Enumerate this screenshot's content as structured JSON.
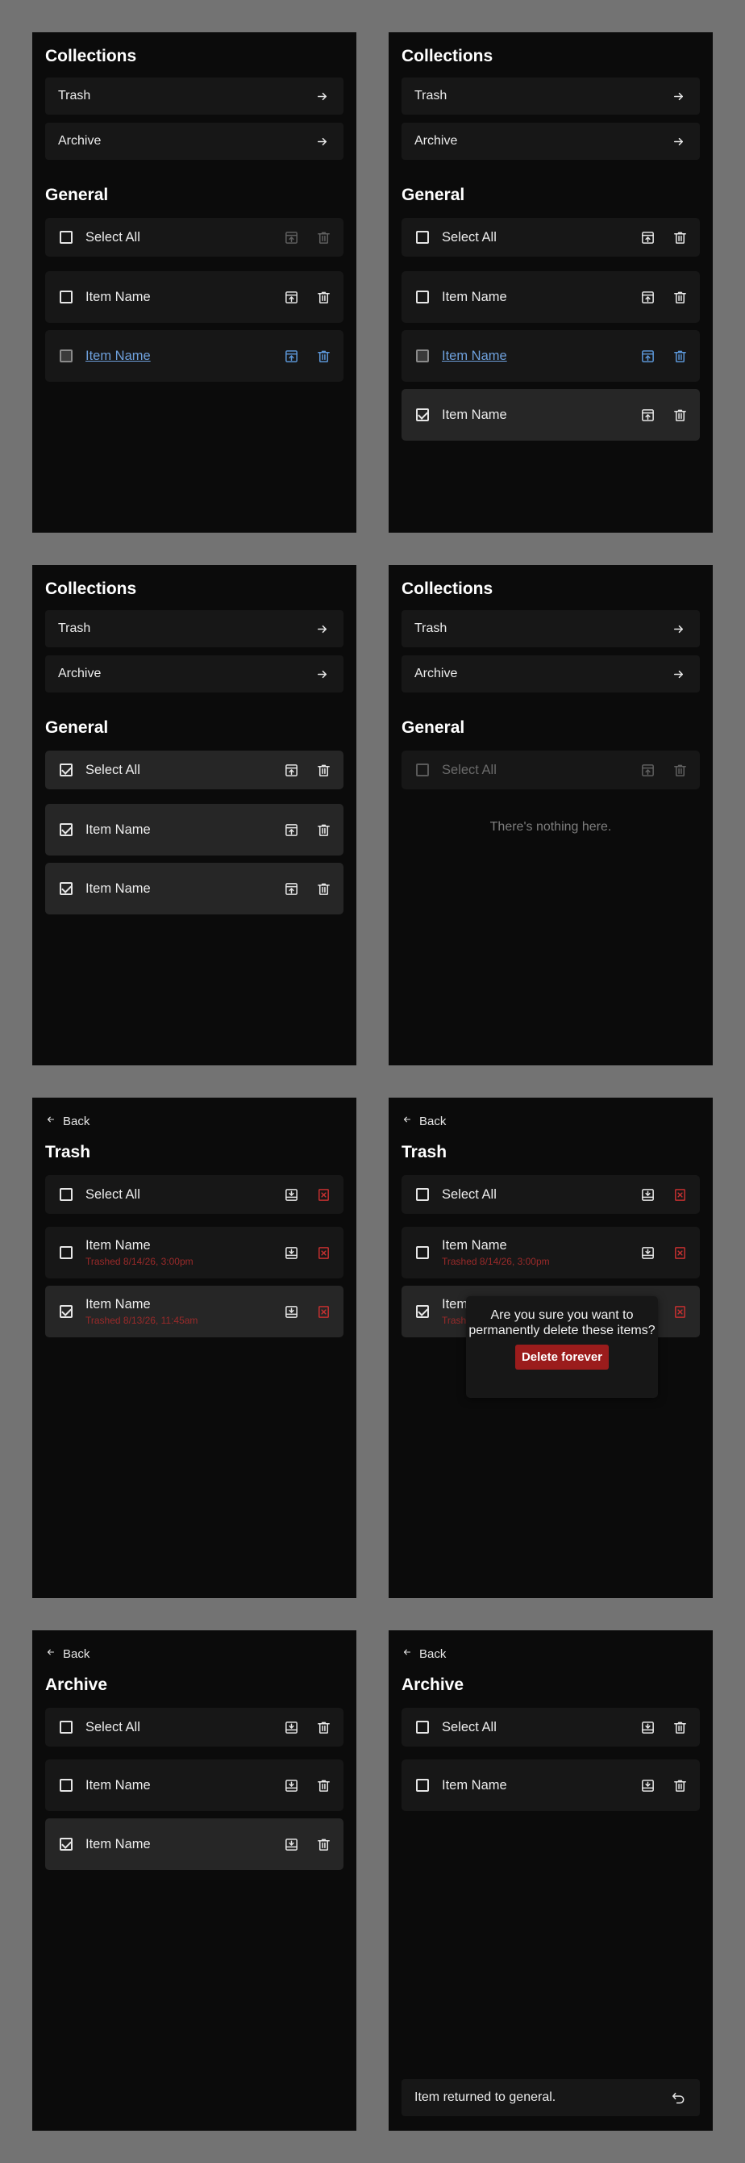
{
  "labels": {
    "collections": "Collections",
    "trash": "Trash",
    "archive": "Archive",
    "general": "General",
    "select_all": "Select All",
    "item_name": "Item Name",
    "back": "Back",
    "empty": "There's nothing here.",
    "trashed_1": "Trashed 8/14/26, 3:00pm",
    "trashed_2": "Trashed 8/13/26, 11:45am",
    "confirm": "Are you sure you want to permanently delete these items?",
    "delete_forever": "Delete forever",
    "toast": "Item returned to general."
  },
  "colors": {
    "panel_bg": "#0b0b0b",
    "row_bg": "#171717",
    "selected_row_bg": "#262626",
    "hover_link": "#6ea0dc",
    "danger": "#c23030",
    "page_bg": "#737373"
  },
  "icons": [
    "arrow-right-icon",
    "archive-icon",
    "trash-icon",
    "unarchive-icon",
    "delete-x-icon",
    "arrow-left-icon",
    "undo-icon"
  ]
}
